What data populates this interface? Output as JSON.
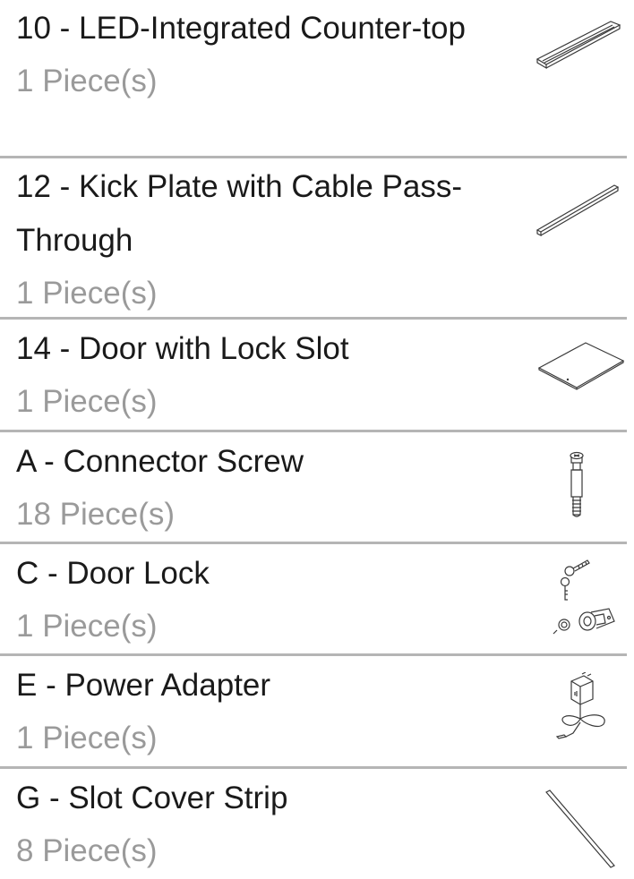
{
  "parts": [
    {
      "name": "10 - LED-Integrated Counter-top",
      "qty": "1 Piece(s)",
      "icon": "countertop-panel-icon"
    },
    {
      "name": "12 - Kick Plate with Cable Pass-Through",
      "qty": "1 Piece(s)",
      "icon": "kick-plate-icon"
    },
    {
      "name": "14 - Door with Lock Slot",
      "qty": "1 Piece(s)",
      "icon": "door-panel-icon"
    },
    {
      "name": "A - Connector Screw",
      "qty": "18 Piece(s)",
      "icon": "connector-screw-icon"
    },
    {
      "name": "C - Door Lock",
      "qty": "1 Piece(s)",
      "icon": "door-lock-icon"
    },
    {
      "name": "E - Power Adapter",
      "qty": "1 Piece(s)",
      "icon": "power-adapter-icon"
    },
    {
      "name": "G - Slot Cover Strip",
      "qty": "8 Piece(s)",
      "icon": "slot-cover-strip-icon"
    }
  ]
}
